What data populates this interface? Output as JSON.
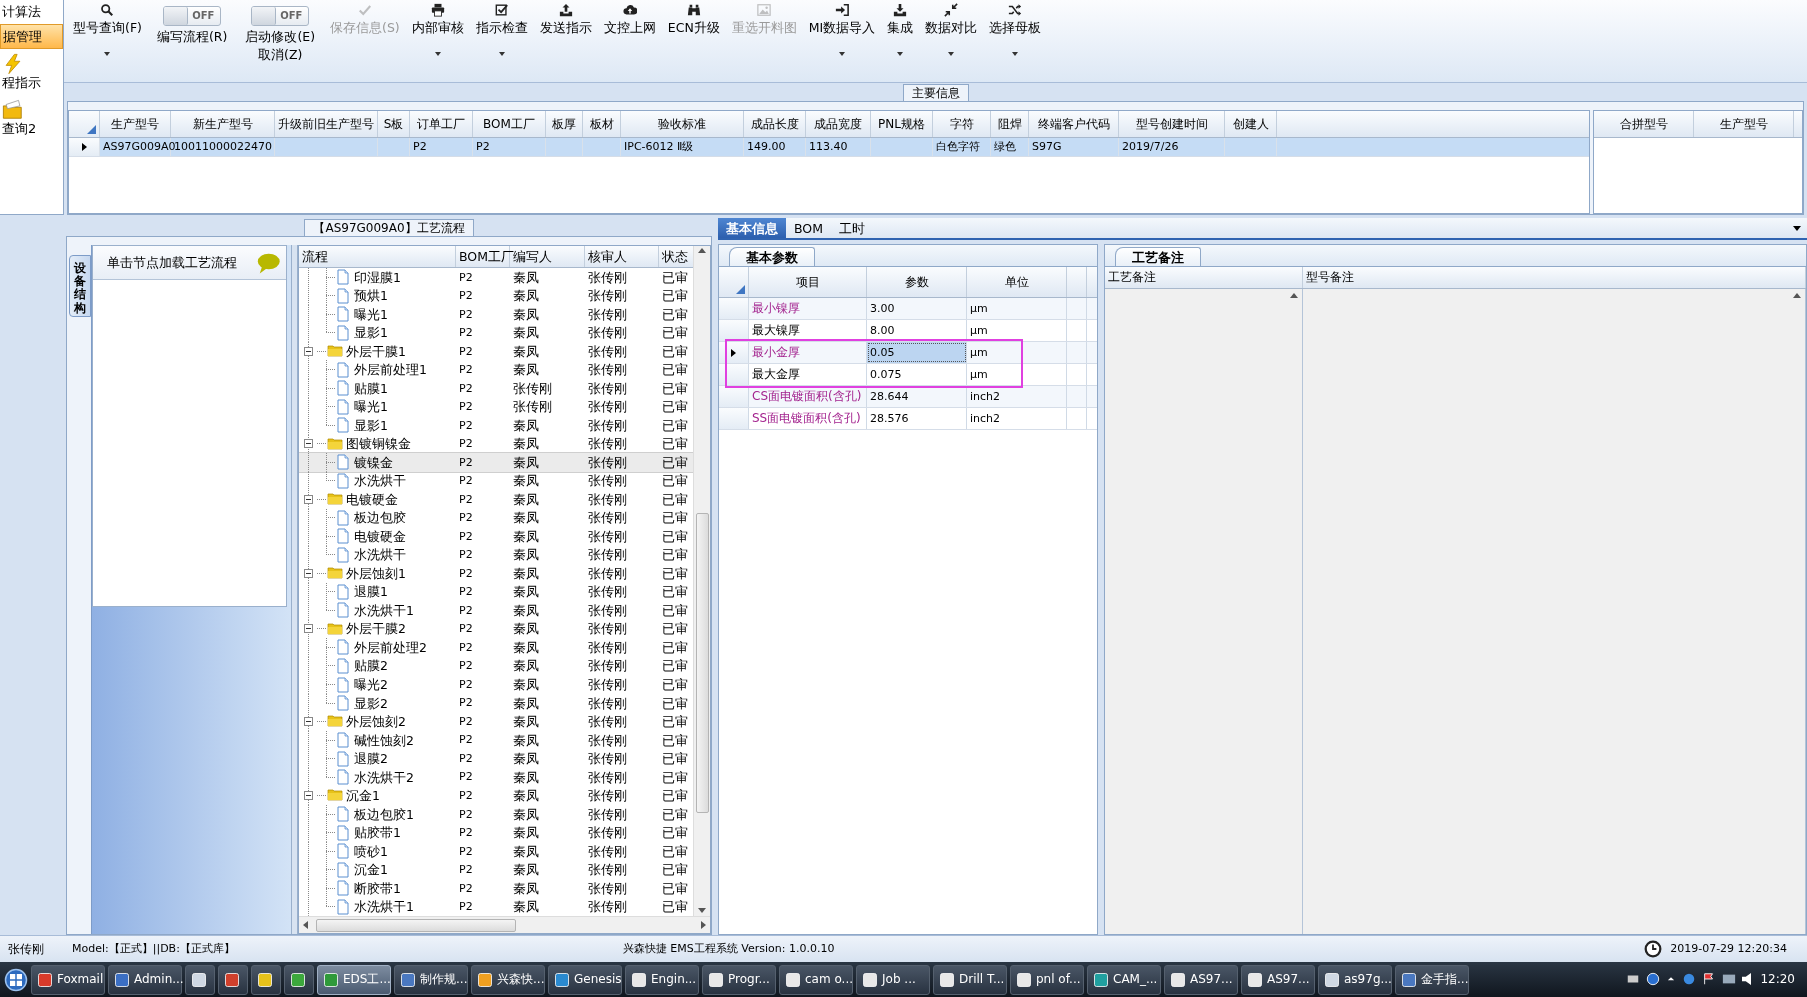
{
  "sidebar": {
    "items": [
      {
        "kind": "text",
        "label": "计算法",
        "selected": false
      },
      {
        "kind": "text",
        "label": "据管理",
        "selected": true
      },
      {
        "kind": "icon",
        "label": "程指示",
        "selected": false
      },
      {
        "kind": "icon",
        "label": "查询2",
        "selected": false
      }
    ]
  },
  "toolbar": {
    "items": [
      {
        "kind": "button",
        "label": "型号查询(F)",
        "disabled": false,
        "menu": true
      },
      {
        "kind": "toggle",
        "state_text": "OFF",
        "on": false,
        "label": "编写流程(R)"
      },
      {
        "kind": "toggle",
        "state_text": "OFF",
        "on": false,
        "label": "启动修改(E)",
        "sublabel": "取消(Z)"
      },
      {
        "kind": "button",
        "label": "保存信息(S)",
        "disabled": true,
        "menu": false
      },
      {
        "kind": "button",
        "label": "内部审核",
        "disabled": false,
        "menu": true
      },
      {
        "kind": "button",
        "label": "指示检查",
        "disabled": false,
        "menu": true
      },
      {
        "kind": "button",
        "label": "发送指示",
        "disabled": false,
        "menu": false
      },
      {
        "kind": "button",
        "label": "文控上网",
        "disabled": false,
        "menu": false
      },
      {
        "kind": "button",
        "label": "ECN升级",
        "disabled": false,
        "menu": false
      },
      {
        "kind": "button",
        "label": "重选开料图",
        "disabled": true,
        "menu": false
      },
      {
        "kind": "button",
        "label": "MI数据导入",
        "disabled": false,
        "menu": true
      },
      {
        "kind": "button",
        "label": "集成",
        "disabled": false,
        "menu": true
      },
      {
        "kind": "button",
        "label": "数据对比",
        "disabled": false,
        "menu": true
      },
      {
        "kind": "button",
        "label": "选择母板",
        "disabled": false,
        "menu": true
      }
    ]
  },
  "main_info": {
    "title": "主要信息",
    "columns": [
      "生产型号",
      "新生产型号",
      "升级前旧生产型号",
      "S板",
      "订单工厂",
      "BOM工厂",
      "板厚",
      "板材",
      "验收标准",
      "成品长度",
      "成品宽度",
      "PNL规格",
      "字符",
      "阻焊",
      "终端客户代码",
      "型号创建时间",
      "创建人"
    ],
    "rows": [
      {
        "selected": true,
        "cells": [
          "AS97G009A0",
          "10011000022470",
          null,
          null,
          "P2",
          "P2",
          null,
          null,
          "IPC-6012 Ⅱ级",
          "149.00",
          "113.40",
          null,
          "白色字符",
          "绿色",
          "S97G",
          "2019/7/26",
          null
        ]
      }
    ],
    "side_table": {
      "columns": [
        "合拼型号",
        "生产型号"
      ]
    }
  },
  "process_flow": {
    "title": "【AS97G009A0】工艺流程",
    "side_tab": "设备结构",
    "hint": "单击节点加载工艺流程",
    "columns": [
      "流程",
      "BOM工厂",
      "编写人",
      "核审人",
      "状态"
    ],
    "nodes": [
      {
        "kind": "group",
        "children": [
          {
            "kind": "step",
            "label": "印湿膜1",
            "bom_factory": "P2",
            "author": "秦凤",
            "reviewer": "张传刚",
            "status": "已审",
            "selected": false
          },
          {
            "kind": "step",
            "label": "预烘1",
            "bom_factory": "P2",
            "author": "秦凤",
            "reviewer": "张传刚",
            "status": "已审",
            "selected": false
          },
          {
            "kind": "step",
            "label": "曝光1",
            "bom_factory": "P2",
            "author": "秦凤",
            "reviewer": "张传刚",
            "status": "已审",
            "selected": false
          },
          {
            "kind": "step",
            "label": "显影1",
            "bom_factory": "P2",
            "author": "秦凤",
            "reviewer": "张传刚",
            "status": "已审",
            "selected": false
          }
        ]
      },
      {
        "kind": "folder",
        "label": "外层干膜1",
        "bom_factory": "P2",
        "author": "秦凤",
        "reviewer": "张传刚",
        "status": "已审",
        "expanded": true,
        "selected": false,
        "children": [
          {
            "kind": "step",
            "label": "外层前处理1",
            "bom_factory": "P2",
            "author": "秦凤",
            "reviewer": "张传刚",
            "status": "已审",
            "selected": false
          },
          {
            "kind": "step",
            "label": "贴膜1",
            "bom_factory": "P2",
            "author": "张传刚",
            "reviewer": "张传刚",
            "status": "已审",
            "selected": false
          },
          {
            "kind": "step",
            "label": "曝光1",
            "bom_factory": "P2",
            "author": "张传刚",
            "reviewer": "张传刚",
            "status": "已审",
            "selected": false
          },
          {
            "kind": "step",
            "label": "显影1",
            "bom_factory": "P2",
            "author": "秦凤",
            "reviewer": "张传刚",
            "status": "已审",
            "selected": false
          }
        ]
      },
      {
        "kind": "folder",
        "label": "图镀铜镍金",
        "bom_factory": "P2",
        "author": "秦凤",
        "reviewer": "张传刚",
        "status": "已审",
        "expanded": true,
        "selected": false,
        "children": [
          {
            "kind": "step",
            "label": "镀镍金",
            "bom_factory": "P2",
            "author": "秦凤",
            "reviewer": "张传刚",
            "status": "已审",
            "selected": true
          },
          {
            "kind": "step",
            "label": "水洗烘干",
            "bom_factory": "P2",
            "author": "秦凤",
            "reviewer": "张传刚",
            "status": "已审",
            "selected": false
          }
        ]
      },
      {
        "kind": "folder",
        "label": "电镀硬金",
        "bom_factory": "P2",
        "author": "秦凤",
        "reviewer": "张传刚",
        "status": "已审",
        "expanded": true,
        "selected": false,
        "children": [
          {
            "kind": "step",
            "label": "板边包胶",
            "bom_factory": "P2",
            "author": "秦凤",
            "reviewer": "张传刚",
            "status": "已审",
            "selected": false
          },
          {
            "kind": "step",
            "label": "电镀硬金",
            "bom_factory": "P2",
            "author": "秦凤",
            "reviewer": "张传刚",
            "status": "已审",
            "selected": false
          },
          {
            "kind": "step",
            "label": "水洗烘干",
            "bom_factory": "P2",
            "author": "秦凤",
            "reviewer": "张传刚",
            "status": "已审",
            "selected": false
          }
        ]
      },
      {
        "kind": "folder",
        "label": "外层蚀刻1",
        "bom_factory": "P2",
        "author": "秦凤",
        "reviewer": "张传刚",
        "status": "已审",
        "expanded": true,
        "selected": false,
        "children": [
          {
            "kind": "step",
            "label": "退膜1",
            "bom_factory": "P2",
            "author": "秦凤",
            "reviewer": "张传刚",
            "status": "已审",
            "selected": false
          },
          {
            "kind": "step",
            "label": "水洗烘干1",
            "bom_factory": "P2",
            "author": "秦凤",
            "reviewer": "张传刚",
            "status": "已审",
            "selected": false
          }
        ]
      },
      {
        "kind": "folder",
        "label": "外层干膜2",
        "bom_factory": "P2",
        "author": "秦凤",
        "reviewer": "张传刚",
        "status": "已审",
        "expanded": true,
        "selected": false,
        "children": [
          {
            "kind": "step",
            "label": "外层前处理2",
            "bom_factory": "P2",
            "author": "秦凤",
            "reviewer": "张传刚",
            "status": "已审",
            "selected": false
          },
          {
            "kind": "step",
            "label": "贴膜2",
            "bom_factory": "P2",
            "author": "秦凤",
            "reviewer": "张传刚",
            "status": "已审",
            "selected": false
          },
          {
            "kind": "step",
            "label": "曝光2",
            "bom_factory": "P2",
            "author": "秦凤",
            "reviewer": "张传刚",
            "status": "已审",
            "selected": false
          },
          {
            "kind": "step",
            "label": "显影2",
            "bom_factory": "P2",
            "author": "秦凤",
            "reviewer": "张传刚",
            "status": "已审",
            "selected": false
          }
        ]
      },
      {
        "kind": "folder",
        "label": "外层蚀刻2",
        "bom_factory": "P2",
        "author": "秦凤",
        "reviewer": "张传刚",
        "status": "已审",
        "expanded": true,
        "selected": false,
        "children": [
          {
            "kind": "step",
            "label": "碱性蚀刻2",
            "bom_factory": "P2",
            "author": "秦凤",
            "reviewer": "张传刚",
            "status": "已审",
            "selected": false
          },
          {
            "kind": "step",
            "label": "退膜2",
            "bom_factory": "P2",
            "author": "秦凤",
            "reviewer": "张传刚",
            "status": "已审",
            "selected": false
          },
          {
            "kind": "step",
            "label": "水洗烘干2",
            "bom_factory": "P2",
            "author": "秦凤",
            "reviewer": "张传刚",
            "status": "已审",
            "selected": false
          }
        ]
      },
      {
        "kind": "folder",
        "label": "沉金1",
        "bom_factory": "P2",
        "author": "秦凤",
        "reviewer": "张传刚",
        "status": "已审",
        "expanded": true,
        "selected": false,
        "children": [
          {
            "kind": "step",
            "label": "板边包胶1",
            "bom_factory": "P2",
            "author": "秦凤",
            "reviewer": "张传刚",
            "status": "已审",
            "selected": false
          },
          {
            "kind": "step",
            "label": "贴胶带1",
            "bom_factory": "P2",
            "author": "秦凤",
            "reviewer": "张传刚",
            "status": "已审",
            "selected": false
          },
          {
            "kind": "step",
            "label": "喷砂1",
            "bom_factory": "P2",
            "author": "秦凤",
            "reviewer": "张传刚",
            "status": "已审",
            "selected": false
          },
          {
            "kind": "step",
            "label": "沉金1",
            "bom_factory": "P2",
            "author": "秦凤",
            "reviewer": "张传刚",
            "status": "已审",
            "selected": false
          },
          {
            "kind": "step",
            "label": "断胶带1",
            "bom_factory": "P2",
            "author": "秦凤",
            "reviewer": "张传刚",
            "status": "已审",
            "selected": false
          },
          {
            "kind": "step",
            "label": "水洗烘干1",
            "bom_factory": "P2",
            "author": "秦凤",
            "reviewer": "张传刚",
            "status": "已审",
            "selected": false
          }
        ]
      }
    ]
  },
  "detail": {
    "tabs": [
      {
        "label": "基本信息",
        "selected": true
      },
      {
        "label": "BOM",
        "selected": false
      },
      {
        "label": "工时",
        "selected": false
      }
    ],
    "params": {
      "tab": "基本参数",
      "columns": [
        "项目",
        "参数",
        "单位"
      ],
      "rows": [
        {
          "name": "最小镍厚",
          "value": "3.00",
          "unit": "μm",
          "highlighted": true,
          "selected": false,
          "outlined": false
        },
        {
          "name": "最大镍厚",
          "value": "8.00",
          "unit": "μm",
          "highlighted": false,
          "selected": false,
          "outlined": false
        },
        {
          "name": "最小金厚",
          "value": "0.05",
          "unit": "μm",
          "highlighted": true,
          "selected": true,
          "outlined": true
        },
        {
          "name": "最大金厚",
          "value": "0.075",
          "unit": "μm",
          "highlighted": false,
          "selected": false,
          "outlined": true
        },
        {
          "name": "CS面电镀面积(含孔)",
          "value": "28.644",
          "unit": "inch2",
          "highlighted": true,
          "selected": false,
          "outlined": false
        },
        {
          "name": "SS面电镀面积(含孔)",
          "value": "28.576",
          "unit": "inch2",
          "highlighted": true,
          "selected": false,
          "outlined": false
        }
      ]
    },
    "notes": {
      "tab": "工艺备注",
      "columns": [
        "工艺备注",
        "型号备注"
      ]
    }
  },
  "status_bar": {
    "user": "张传刚",
    "model": "Model:【正式】||DB:【正式库】",
    "app": "兴森快捷 EMS工程系统 Version: 1.0.0.10",
    "datetime": "2019-07-29 12:20:34"
  },
  "taskbar": {
    "buttons": [
      {
        "kind": "app",
        "label": "Foxmail",
        "selected": false
      },
      {
        "kind": "app",
        "label": "Admin...",
        "selected": false
      },
      {
        "kind": "icon",
        "selected": false
      },
      {
        "kind": "icon",
        "selected": false
      },
      {
        "kind": "icon",
        "selected": false
      },
      {
        "kind": "icon",
        "selected": false
      },
      {
        "kind": "app",
        "label": "EDS工...",
        "selected": true
      },
      {
        "kind": "app",
        "label": "制作规...",
        "selected": false
      },
      {
        "kind": "app",
        "label": "兴森快...",
        "selected": false
      },
      {
        "kind": "app",
        "label": "Genesis",
        "selected": false
      },
      {
        "kind": "app",
        "label": "Engin...",
        "selected": false
      },
      {
        "kind": "app",
        "label": "Progr...",
        "selected": false
      },
      {
        "kind": "app",
        "label": "cam o...",
        "selected": false
      },
      {
        "kind": "app",
        "label": "Job ...",
        "selected": false
      },
      {
        "kind": "app",
        "label": "Drill T...",
        "selected": false
      },
      {
        "kind": "app",
        "label": "pnl of...",
        "selected": false
      },
      {
        "kind": "app",
        "label": "CAM_...",
        "selected": false
      },
      {
        "kind": "app",
        "label": "AS97...",
        "selected": false
      },
      {
        "kind": "app",
        "label": "AS97...",
        "selected": false
      },
      {
        "kind": "app",
        "label": "as97g...",
        "selected": false
      },
      {
        "kind": "app",
        "label": "金手指...",
        "selected": false
      }
    ],
    "clock": "12:20"
  }
}
